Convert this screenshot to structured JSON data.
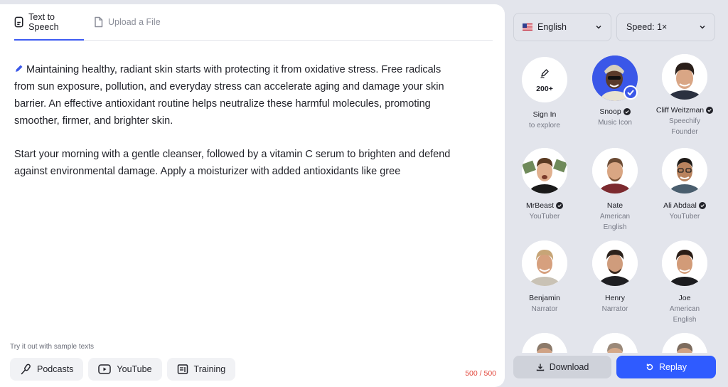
{
  "tabs": [
    {
      "label": "Text to Speech",
      "active": true,
      "icon": "document-icon"
    },
    {
      "label": "Upload a File",
      "active": false,
      "icon": "file-icon"
    }
  ],
  "editor": {
    "paragraphs": [
      "Maintaining healthy, radiant skin starts with protecting it from oxidative stress. Free radicals from sun exposure, pollution, and everyday stress can accelerate aging and damage your skin barrier. An effective antioxidant routine helps neutralize these harmful molecules, promoting smoother, firmer, and brighter skin.",
      "Start your morning with a gentle cleanser, followed by a vitamin C serum to brighten and defend against environmental damage. Apply a moisturizer with added antioxidants like gree"
    ],
    "char_count": "500 / 500"
  },
  "samples": {
    "label": "Try it out with sample texts",
    "chips": [
      {
        "label": "Podcasts",
        "icon": "microphone-icon"
      },
      {
        "label": "YouTube",
        "icon": "play-icon"
      },
      {
        "label": "Training",
        "icon": "training-icon"
      }
    ]
  },
  "controls": {
    "language": "English",
    "speed": "Speed: 1×"
  },
  "voices": [
    {
      "name": "Sign In",
      "sub": "to explore",
      "badge": "200+",
      "verified": false,
      "selected": false
    },
    {
      "name": "Snoop",
      "sub": "Music Icon",
      "verified": true,
      "selected": true
    },
    {
      "name": "Cliff Weitzman",
      "sub": "Speechify Founder",
      "verified": true,
      "selected": false
    },
    {
      "name": "MrBeast",
      "sub": "YouTuber",
      "verified": true,
      "selected": false
    },
    {
      "name": "Nate",
      "sub": "American English",
      "verified": false,
      "selected": false
    },
    {
      "name": "Ali Abdaal",
      "sub": "YouTuber",
      "verified": true,
      "selected": false
    },
    {
      "name": "Benjamin",
      "sub": "Narrator",
      "verified": false,
      "selected": false
    },
    {
      "name": "Henry",
      "sub": "Narrator",
      "verified": false,
      "selected": false
    },
    {
      "name": "Joe",
      "sub": "American English",
      "verified": false,
      "selected": false
    }
  ],
  "actions": {
    "download": "Download",
    "replay": "Replay"
  },
  "colors": {
    "accent": "#2f5bff",
    "counter": "#e2463b",
    "sidebar_bg": "#e3e5ec"
  }
}
